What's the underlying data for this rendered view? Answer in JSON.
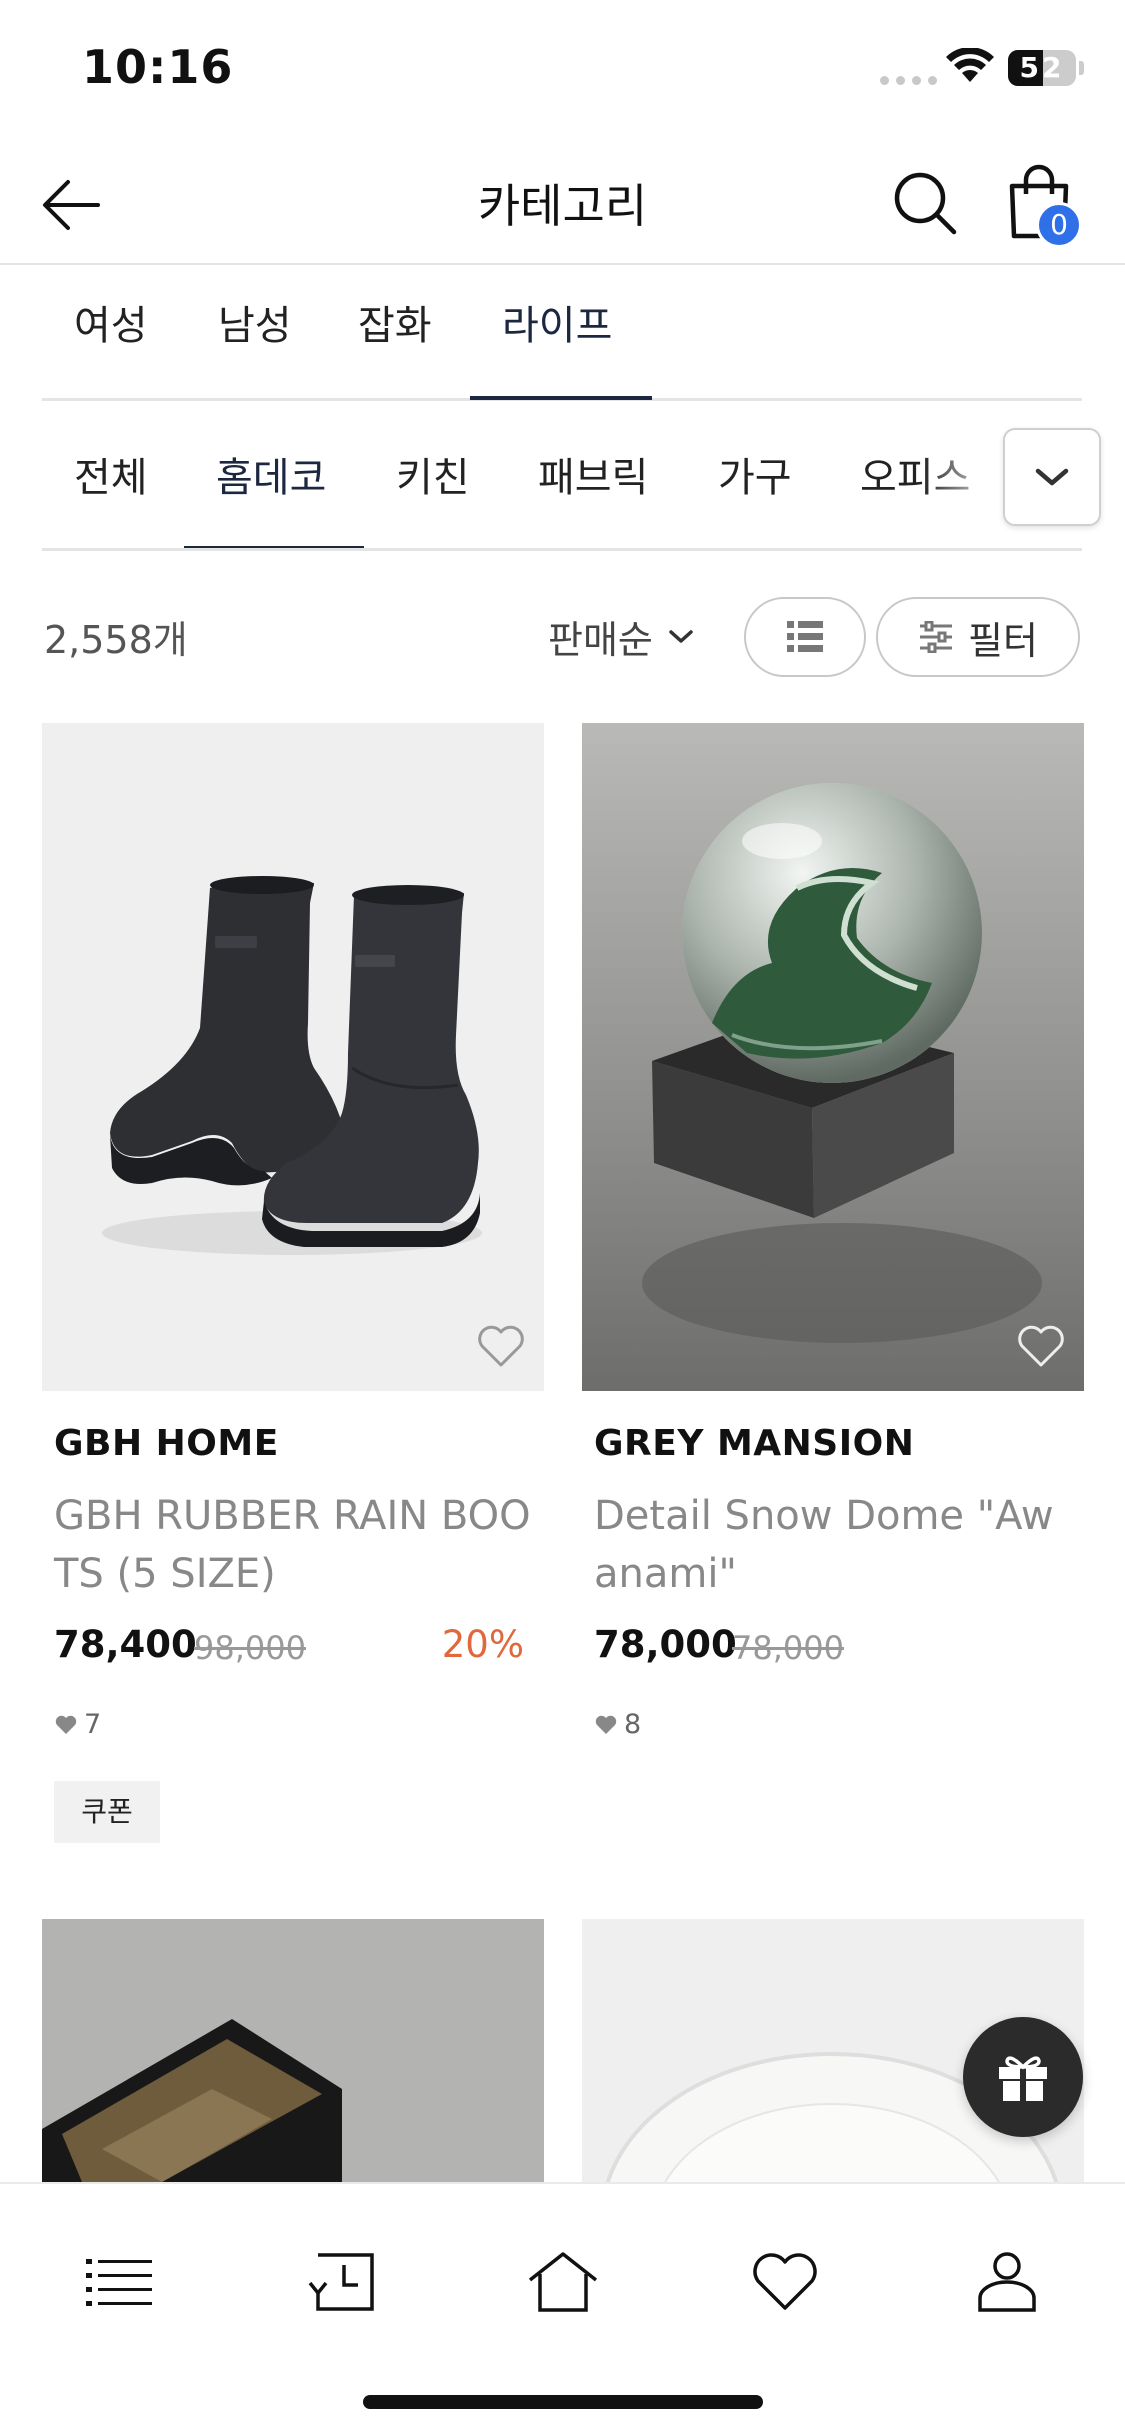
{
  "status_bar": {
    "time": "10:16",
    "battery": "52",
    "battery_level": 0.52
  },
  "header": {
    "title": "카테고리",
    "cart_count": "0"
  },
  "main_tabs": [
    {
      "label": "여성",
      "active": false
    },
    {
      "label": "남성",
      "active": false
    },
    {
      "label": "잡화",
      "active": false
    },
    {
      "label": "라이프",
      "active": true
    }
  ],
  "sub_tabs": [
    {
      "label": "전체",
      "active": false
    },
    {
      "label": "홈데코",
      "active": true
    },
    {
      "label": "키친",
      "active": false
    },
    {
      "label": "패브릭",
      "active": false
    },
    {
      "label": "가구",
      "active": false
    },
    {
      "label": "오피스",
      "active": false
    }
  ],
  "toolbar": {
    "count": "2,558개",
    "sort_label": "판매순",
    "filter_label": "필터"
  },
  "products": [
    {
      "brand": "GBH HOME",
      "name": "GBH RUBBER RAIN BOOTS (5 SIZE)",
      "price": "78,400",
      "original_price": "98,000",
      "discount": "20%",
      "likes": "7",
      "coupon": "쿠폰",
      "image": "black-rubber-rain-boots"
    },
    {
      "brand": "GREY MANSION",
      "name": "Detail Snow Dome \"Awanami\"",
      "price": "78,000",
      "original_price": "78,000",
      "discount": "",
      "likes": "8",
      "coupon": "",
      "image": "wave-snow-globe"
    }
  ],
  "icons": {
    "back": "arrow-left-icon",
    "search": "search-icon",
    "cart": "shopping-bag-icon",
    "expand": "chevron-down-icon",
    "sort": "chevron-down-icon",
    "view": "list-view-icon",
    "filter": "sliders-icon",
    "wish": "heart-outline-icon",
    "gift": "gift-icon",
    "nav": [
      "menu-icon",
      "recent-icon",
      "home-icon",
      "heart-icon",
      "user-icon"
    ]
  },
  "colors": {
    "accent": "#1c2740",
    "badge": "#2f6fe8",
    "discount": "#e0683c",
    "fab": "#2b2b2b"
  }
}
